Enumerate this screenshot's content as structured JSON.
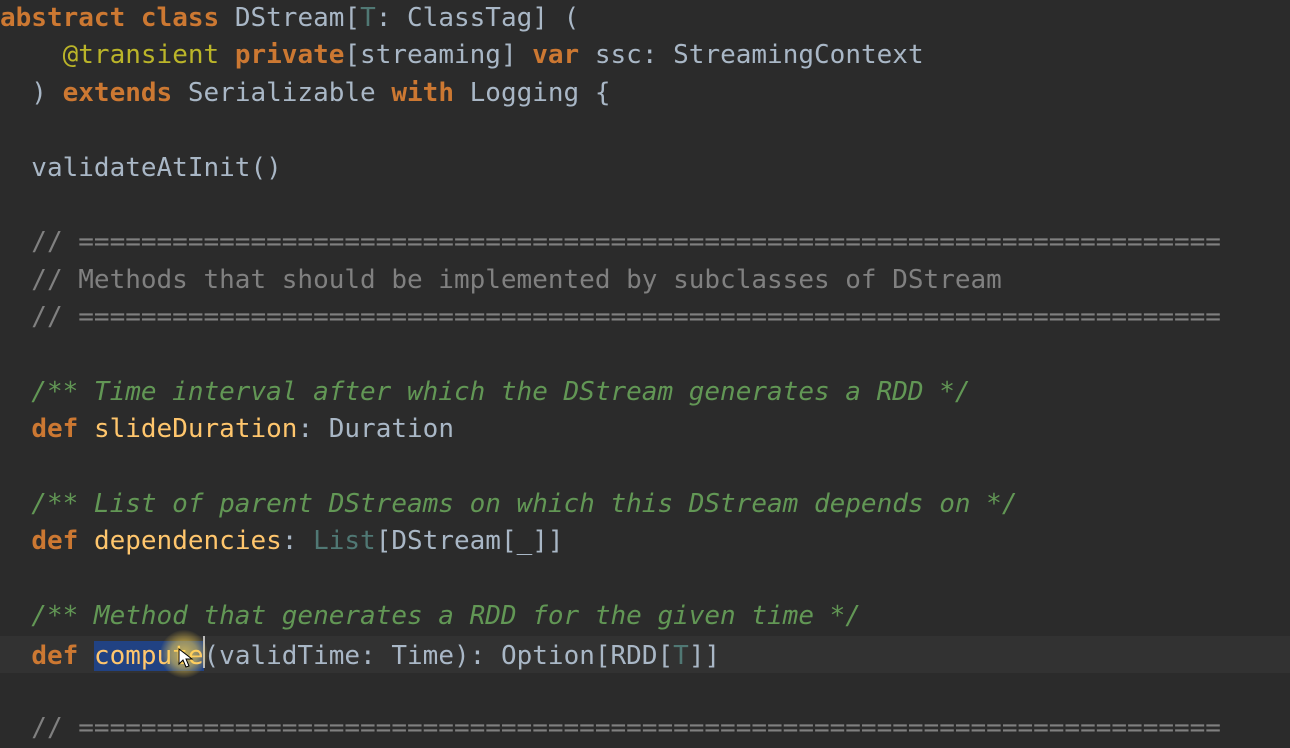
{
  "colors": {
    "background": "#2b2b2b",
    "keyword": "#cc7832",
    "identifier": "#a9b7c6",
    "typeParam": "#507874",
    "annotation": "#bbb529",
    "comment": "#808080",
    "doc": "#629755",
    "function": "#ffc66d",
    "selection": "#214283",
    "currentLine": "#323232"
  },
  "cursor": {
    "line_index": 17,
    "selected_word": "compute"
  },
  "lines": [
    {
      "tokens": [
        {
          "t": "abstract",
          "c": "kw"
        },
        {
          "t": " "
        },
        {
          "t": "class",
          "c": "kw"
        },
        {
          "t": " "
        },
        {
          "t": "DStream",
          "c": "type"
        },
        {
          "t": "["
        },
        {
          "t": "T",
          "c": "tp"
        },
        {
          "t": ": "
        },
        {
          "t": "ClassTag",
          "c": "type"
        },
        {
          "t": "] ("
        }
      ]
    },
    {
      "tokens": [
        {
          "t": "    "
        },
        {
          "t": "@transient",
          "c": "anno"
        },
        {
          "t": " "
        },
        {
          "t": "private",
          "c": "kw"
        },
        {
          "t": "[streaming] "
        },
        {
          "t": "var",
          "c": "kw"
        },
        {
          "t": " ssc: "
        },
        {
          "t": "StreamingContext",
          "c": "type"
        }
      ]
    },
    {
      "tokens": [
        {
          "t": "  ) "
        },
        {
          "t": "extends",
          "c": "kw"
        },
        {
          "t": " "
        },
        {
          "t": "Serializable",
          "c": "type"
        },
        {
          "t": " "
        },
        {
          "t": "with",
          "c": "kw"
        },
        {
          "t": " "
        },
        {
          "t": "Logging",
          "c": "type"
        },
        {
          "t": " {"
        }
      ]
    },
    {
      "tokens": [
        {
          "t": ""
        }
      ]
    },
    {
      "tokens": [
        {
          "t": "  validateAtInit()",
          "c": "ident"
        }
      ]
    },
    {
      "tokens": [
        {
          "t": ""
        }
      ]
    },
    {
      "tokens": [
        {
          "t": "  // =========================================================================",
          "c": "cm"
        }
      ]
    },
    {
      "tokens": [
        {
          "t": "  // Methods that should be implemented by subclasses of DStream",
          "c": "cm"
        }
      ]
    },
    {
      "tokens": [
        {
          "t": "  // =========================================================================",
          "c": "cm"
        }
      ]
    },
    {
      "tokens": [
        {
          "t": ""
        }
      ]
    },
    {
      "tokens": [
        {
          "t": "  /** Time interval after which the DStream generates a RDD */",
          "c": "doc"
        }
      ]
    },
    {
      "tokens": [
        {
          "t": "  "
        },
        {
          "t": "def",
          "c": "kw"
        },
        {
          "t": " "
        },
        {
          "t": "slideDuration",
          "c": "fn"
        },
        {
          "t": ": "
        },
        {
          "t": "Duration",
          "c": "type"
        }
      ]
    },
    {
      "tokens": [
        {
          "t": ""
        }
      ]
    },
    {
      "tokens": [
        {
          "t": "  /** List of parent DStreams on which this DStream depends on */",
          "c": "doc"
        }
      ]
    },
    {
      "tokens": [
        {
          "t": "  "
        },
        {
          "t": "def",
          "c": "kw"
        },
        {
          "t": " "
        },
        {
          "t": "dependencies",
          "c": "fn"
        },
        {
          "t": ": "
        },
        {
          "t": "List",
          "c": "tp"
        },
        {
          "t": "[DStream[_]]"
        }
      ]
    },
    {
      "tokens": [
        {
          "t": ""
        }
      ]
    },
    {
      "tokens": [
        {
          "t": "  /** Method that generates a RDD for the given time */",
          "c": "doc"
        }
      ]
    },
    {
      "current": true,
      "tokens": [
        {
          "t": "  "
        },
        {
          "t": "def",
          "c": "kw"
        },
        {
          "t": " "
        },
        {
          "t": "compute",
          "c": "fn",
          "sel": true,
          "caret_after": true
        },
        {
          "t": "(validTime: "
        },
        {
          "t": "Time",
          "c": "type"
        },
        {
          "t": "): "
        },
        {
          "t": "Option",
          "c": "type"
        },
        {
          "t": "[RDD["
        },
        {
          "t": "T",
          "c": "tp"
        },
        {
          "t": "]]"
        }
      ]
    },
    {
      "tokens": [
        {
          "t": ""
        }
      ]
    },
    {
      "tokens": [
        {
          "t": "  // =========================================================================",
          "c": "cm"
        }
      ]
    }
  ]
}
